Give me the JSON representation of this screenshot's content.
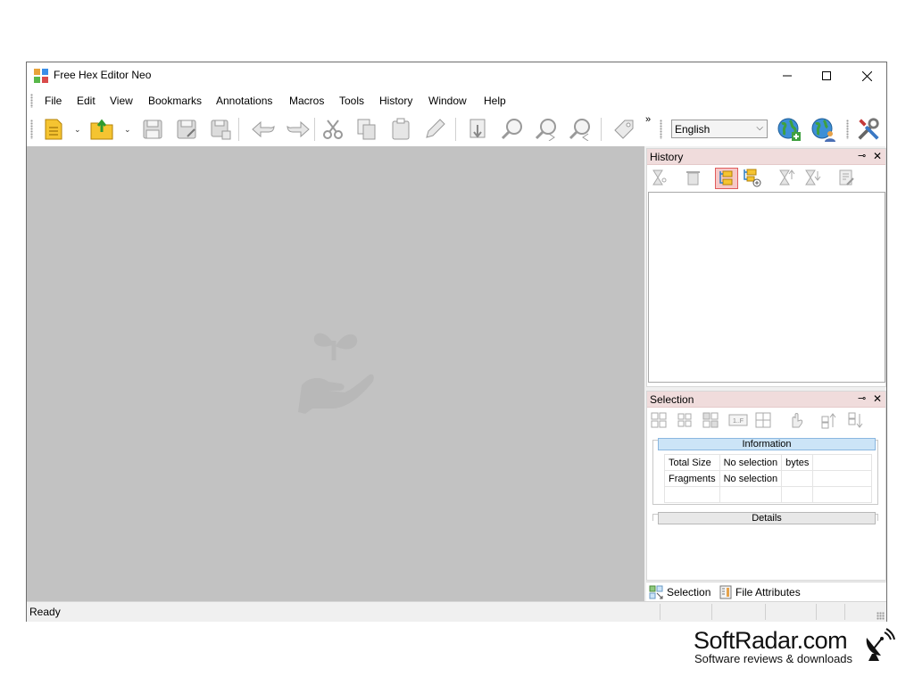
{
  "window": {
    "title": "Free Hex Editor Neo"
  },
  "menu": [
    "File",
    "Edit",
    "View",
    "Bookmarks",
    "Annotations",
    "Macros",
    "Tools",
    "History",
    "Window",
    "Help"
  ],
  "toolbar": {
    "language": "English",
    "overflow_glyph": "»",
    "dropdown_glyph": "⌄",
    "icons": [
      "new-file-icon",
      "open-file-icon",
      "save-icon",
      "save-as-icon",
      "save-all-icon",
      "undo-icon",
      "redo-icon",
      "cut-icon",
      "copy-icon",
      "paste-icon",
      "edit-pencil-icon",
      "export-icon",
      "find-icon",
      "find-next-icon",
      "find-previous-icon",
      "tag-icon",
      "globe-plus-icon",
      "globe-user-icon",
      "tools-icon"
    ]
  },
  "history_panel": {
    "title": "History",
    "pin_glyph": "⊸",
    "close_glyph": "✕"
  },
  "selection_panel": {
    "title": "Selection",
    "information_label": "Information",
    "details_label": "Details",
    "rows": [
      {
        "label": "Total Size",
        "value": "No selection",
        "unit": "bytes"
      },
      {
        "label": "Fragments",
        "value": "No selection",
        "unit": ""
      }
    ]
  },
  "bottom_tabs": [
    "Selection",
    "File Attributes"
  ],
  "status": {
    "text": "Ready"
  },
  "brand": {
    "name": "SoftRadar.com",
    "tagline": "Software reviews & downloads"
  },
  "colors": {
    "accent_panel_header": "#f0dcdc",
    "workspace": "#c2c2c2",
    "group_header": "#cce4f7"
  }
}
